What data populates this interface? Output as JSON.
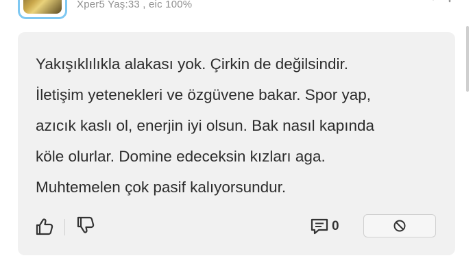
{
  "author": {
    "meta_text": "Xper5 Yaş:33 , eic 100%"
  },
  "comment": {
    "lines": [
      "Yakışıklılıkla alakası yok. Çirkin de değilsindir.",
      "İletişim yetenekleri ve özgüvene bakar. Spor yap,",
      "azıcık kaslı ol, enerjin iyi olsun. Bak nasıl kapında",
      "köle olurlar. Domine edeceksin kızları aga.",
      "Muhtemelen çok pasif kalıyorsundur."
    ]
  },
  "actions": {
    "comment_count": "0",
    "icons": {
      "like": "thumbs-up-icon",
      "dislike": "thumbs-down-icon",
      "comments": "comment-icon",
      "report": "block-icon"
    }
  },
  "colors": {
    "card_background": "#f1f1f1",
    "text": "#2c2c2c",
    "meta_text": "#8f8f8f",
    "avatar_border": "#7ec8f2"
  }
}
